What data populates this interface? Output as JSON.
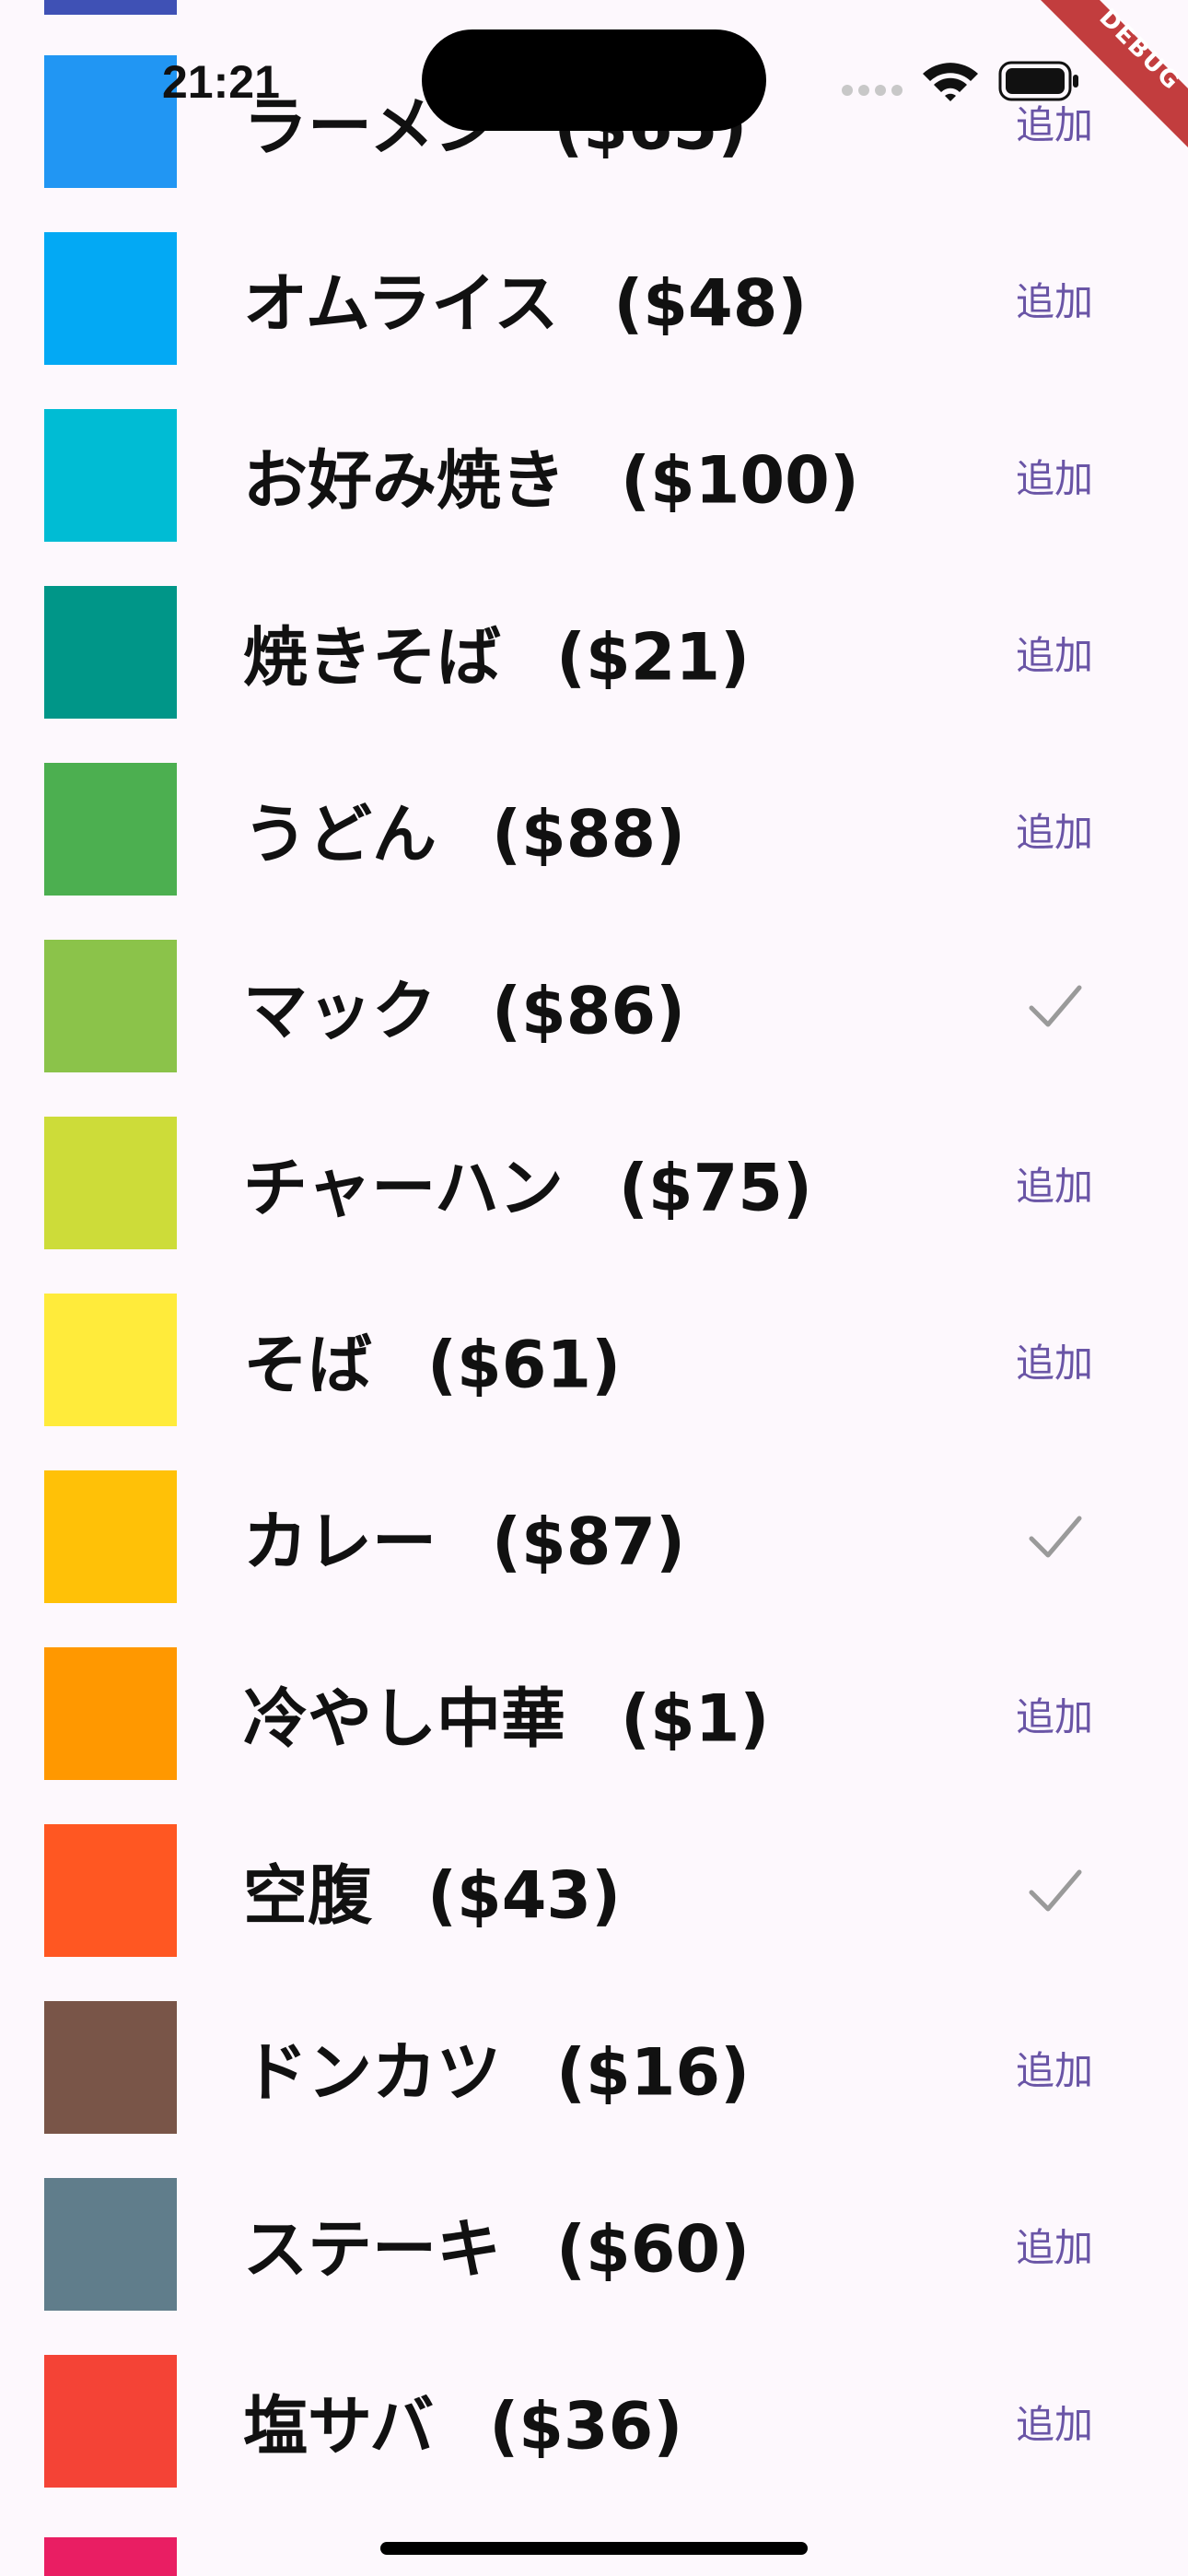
{
  "status_bar": {
    "time": "21:21"
  },
  "debug_label": "DEBUG",
  "top_partial_color": "#3f51b5",
  "bottom_partial_color": "#e91e63",
  "items": [
    {
      "name": "ラーメン",
      "price": "($65)",
      "color": "#2196f3",
      "added": false,
      "action_label": "追加"
    },
    {
      "name": "オムライス",
      "price": "($48)",
      "color": "#03a9f4",
      "added": false,
      "action_label": "追加"
    },
    {
      "name": "お好み焼き",
      "price": "($100)",
      "color": "#00bcd4",
      "added": false,
      "action_label": "追加"
    },
    {
      "name": "焼きそば",
      "price": "($21)",
      "color": "#009688",
      "added": false,
      "action_label": "追加"
    },
    {
      "name": "うどん",
      "price": "($88)",
      "color": "#4caf50",
      "added": false,
      "action_label": "追加"
    },
    {
      "name": "マック",
      "price": "($86)",
      "color": "#8bc34a",
      "added": true,
      "action_label": ""
    },
    {
      "name": "チャーハン",
      "price": "($75)",
      "color": "#cddc39",
      "added": false,
      "action_label": "追加"
    },
    {
      "name": "そば",
      "price": "($61)",
      "color": "#ffeb3b",
      "added": false,
      "action_label": "追加"
    },
    {
      "name": "カレー",
      "price": "($87)",
      "color": "#ffc107",
      "added": true,
      "action_label": ""
    },
    {
      "name": "冷やし中華",
      "price": "($1)",
      "color": "#ff9800",
      "added": false,
      "action_label": "追加"
    },
    {
      "name": "空腹",
      "price": "($43)",
      "color": "#ff5722",
      "added": true,
      "action_label": ""
    },
    {
      "name": "ドンカツ",
      "price": "($16)",
      "color": "#795548",
      "added": false,
      "action_label": "追加"
    },
    {
      "name": "ステーキ",
      "price": "($60)",
      "color": "#607d8b",
      "added": false,
      "action_label": "追加"
    },
    {
      "name": "塩サバ",
      "price": "($36)",
      "color": "#f44336",
      "added": false,
      "action_label": "追加"
    }
  ]
}
